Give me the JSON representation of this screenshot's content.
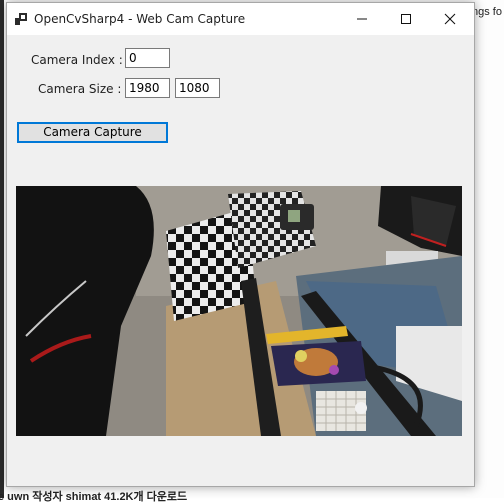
{
  "window": {
    "title": "OpenCvSharp4 - Web Cam Capture"
  },
  "controls": {
    "camera_index_label": "Camera Index :",
    "camera_index_value": "0",
    "camera_size_label": "Camera Size :",
    "camera_width_value": "1980",
    "camera_height_value": "1080",
    "capture_button_label": "Camera Capture"
  },
  "background_text": {
    "top_right": "ngs fo",
    "bottom": "e uwn 작성자 shimat 41.2K개 다운로드"
  },
  "colors": {
    "accent": "#0078d7",
    "window_bg": "#f0f0f0"
  }
}
